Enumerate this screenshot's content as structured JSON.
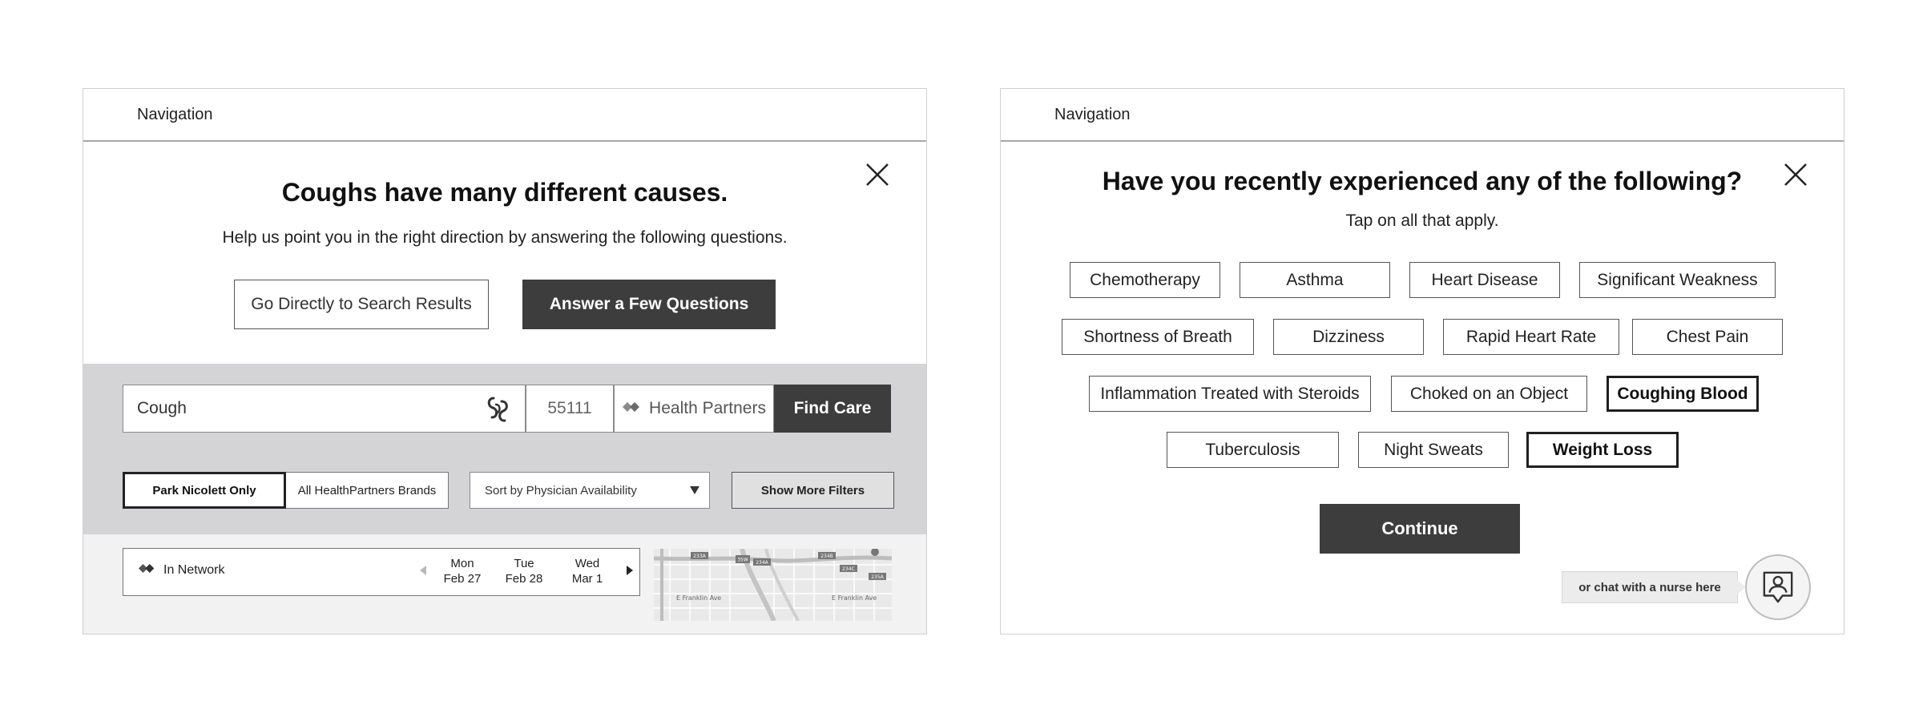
{
  "left_panel": {
    "nav": {
      "label": "Navigation"
    },
    "headline": "Coughs have many different causes.",
    "subline": "Help us point you in the right direction by answering the following questions.",
    "buttons": {
      "search_results": "Go Directly to Search Results",
      "answer_questions": "Answer a Few Questions"
    },
    "search": {
      "symptom_value": "Cough",
      "zip_value": "55111",
      "plan_value": "Health Partners",
      "find_care": "Find Care"
    },
    "filters": {
      "brand_active": "Park Nicolett Only",
      "brand_inactive": "All HealthPartners Brands",
      "sort_value": "Sort by Physician Availability",
      "more_filters": "Show More Filters"
    },
    "result": {
      "network": "In Network",
      "dates": [
        {
          "day": "Mon",
          "date": "Feb 27"
        },
        {
          "day": "Tue",
          "date": "Feb 28"
        },
        {
          "day": "Wed",
          "date": "Mar 1"
        }
      ],
      "map_labels": {
        "road_1": "E Franklin Ave",
        "road_2": "E Franklin Ave",
        "shield_1": "233A",
        "shield_2": "35W",
        "shield_3": "234A",
        "shield_4": "234B",
        "shield_5": "234C",
        "shield_6": "235A"
      }
    }
  },
  "right_panel": {
    "nav": {
      "label": "Navigation"
    },
    "headline": "Have you recently experienced any of the following?",
    "subline": "Tap on all that apply.",
    "conditions": [
      {
        "label": "Chemotherapy",
        "selected": false
      },
      {
        "label": "Asthma",
        "selected": false
      },
      {
        "label": "Heart Disease",
        "selected": false
      },
      {
        "label": "Significant Weakness",
        "selected": false
      },
      {
        "label": "Shortness of Breath",
        "selected": false
      },
      {
        "label": "Dizziness",
        "selected": false
      },
      {
        "label": "Rapid Heart Rate",
        "selected": false
      },
      {
        "label": "Chest Pain",
        "selected": false
      },
      {
        "label": "Inflammation Treated with Steroids",
        "selected": false
      },
      {
        "label": "Choked on an Object",
        "selected": false
      },
      {
        "label": "Coughing Blood",
        "selected": true
      },
      {
        "label": "Tuberculosis",
        "selected": false
      },
      {
        "label": "Night Sweats",
        "selected": false
      },
      {
        "label": "Weight Loss",
        "selected": true
      }
    ],
    "continue": "Continue",
    "chat": "or chat with a nurse here"
  },
  "colors": {
    "dark_button": "#3d3d3d",
    "search_band": "#d4d4d6",
    "results_strip": "#f2f2f2",
    "border": "#555555"
  },
  "icons": {
    "close": "close-icon",
    "symptom": "symptom-icon",
    "plan_logo": "healthpartners-logo-icon",
    "nurse": "nurse-avatar-icon"
  }
}
